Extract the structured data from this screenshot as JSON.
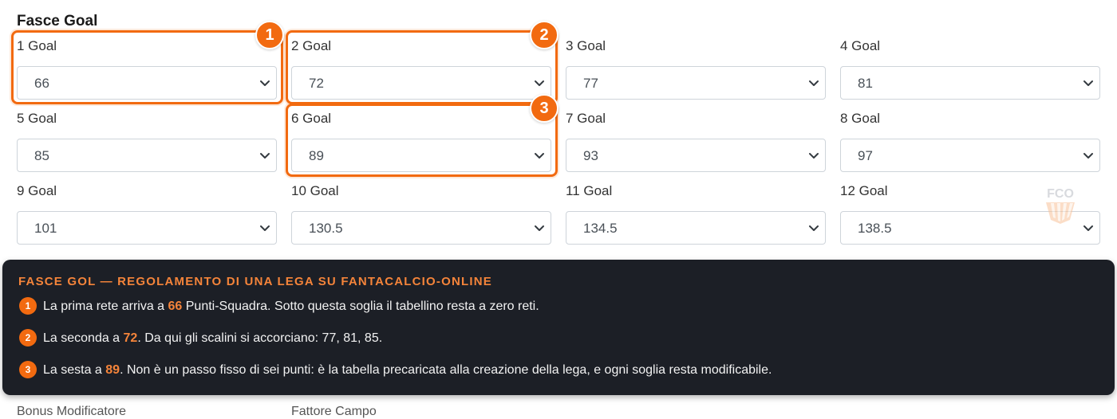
{
  "section_title": "Fasce Goal",
  "fields": [
    {
      "label": "1 Goal",
      "value": "66"
    },
    {
      "label": "2 Goal",
      "value": "72"
    },
    {
      "label": "3 Goal",
      "value": "77"
    },
    {
      "label": "4 Goal",
      "value": "81"
    },
    {
      "label": "5 Goal",
      "value": "85"
    },
    {
      "label": "6 Goal",
      "value": "89"
    },
    {
      "label": "7 Goal",
      "value": "93"
    },
    {
      "label": "8 Goal",
      "value": "97"
    },
    {
      "label": "9 Goal",
      "value": "101"
    },
    {
      "label": "10 Goal",
      "value": "130.5"
    },
    {
      "label": "11 Goal",
      "value": "134.5"
    },
    {
      "label": "12 Goal",
      "value": "138.5"
    }
  ],
  "callout_badges": [
    "1",
    "2",
    "3"
  ],
  "watermark": {
    "text": "FCO"
  },
  "panel": {
    "title": "FASCE GOL — REGOLAMENTO DI UNA LEGA SU FANTACALCIO-ONLINE",
    "lines": [
      {
        "badge": "1",
        "pre": "La prima rete arriva a ",
        "num": "66",
        "post": " Punti-Squadra. Sotto questa soglia il tabellino resta a zero reti."
      },
      {
        "badge": "2",
        "pre": "La seconda a ",
        "num": "72",
        "post": ". Da qui gli scalini si accorciano: 77, 81, 85."
      },
      {
        "badge": "3",
        "pre": "La sesta a ",
        "num": "89",
        "post": ". Non è un passo fisso di sei punti: è la tabella precaricata alla creazione della lega, e ogni soglia resta modificabile."
      }
    ]
  },
  "colors": {
    "accent": "#f26a10",
    "panel_bg": "#1c1f26",
    "panel_accent_text": "#f5843a"
  },
  "cut_row": [
    "Bonus Modificatore",
    "Fattore Campo"
  ]
}
